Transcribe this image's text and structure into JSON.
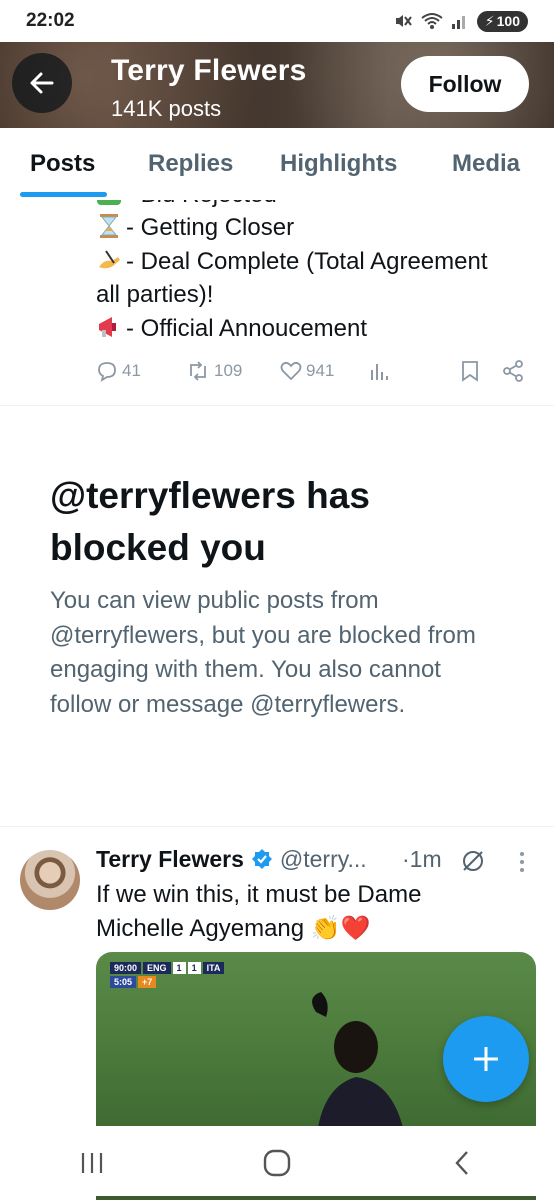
{
  "status_bar": {
    "time": "22:02",
    "battery": "100"
  },
  "profile": {
    "name": "Terry Flewers",
    "posts_count": "141K posts",
    "follow_label": "Follow"
  },
  "tabs": [
    {
      "label": "Posts",
      "active": true
    },
    {
      "label": "Replies",
      "active": false
    },
    {
      "label": "Highlights",
      "active": false
    },
    {
      "label": "Media",
      "active": false
    }
  ],
  "previous_post": {
    "lines": [
      {
        "emoji": "cross-mark-icon",
        "text": "- Bid Rejected"
      },
      {
        "emoji": "hourglass-icon",
        "text": "- Getting Closer"
      },
      {
        "emoji": "writing-hand-icon",
        "text": "- Deal Complete (Total Agreement"
      },
      {
        "emoji": "",
        "text": "all parties)!"
      },
      {
        "emoji": "megaphone-icon",
        "text": "- Official Annoucement"
      }
    ],
    "replies": "41",
    "reposts": "109",
    "likes": "941"
  },
  "blocked_notice": {
    "title": "@terryflewers has blocked you",
    "body": "You can view public posts from @terryflewers, but you are blocked from engaging with them. You also cannot follow or message @terryflewers."
  },
  "tweet": {
    "name": "Terry Flewers",
    "handle": "@terry...",
    "time": "·1m",
    "text": "If we win this, it must be Dame Michelle Agyemang 👏❤️",
    "scorebug": {
      "clock": "90:00",
      "team_a": "ENG",
      "score_a": "1",
      "score_b": "1",
      "team_b": "ITA",
      "stoppage": "5:05",
      "added": "+7"
    }
  },
  "colors": {
    "accent": "#1d9bf0",
    "text_primary": "#0f1419",
    "text_secondary": "#536471"
  }
}
